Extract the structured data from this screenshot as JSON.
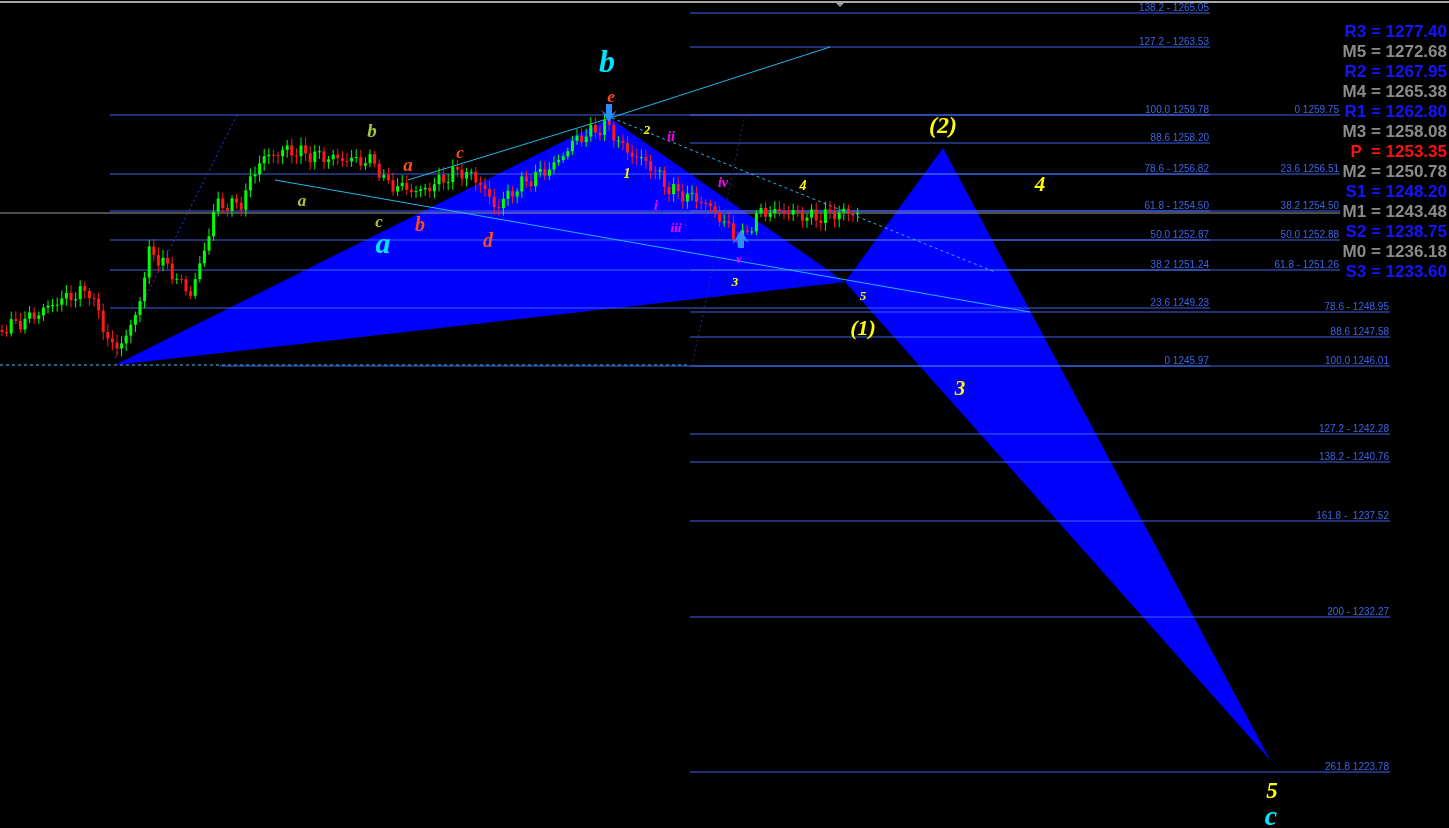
{
  "pivot_levels": [
    {
      "label": "R3 = 1277.40",
      "kind": "resistance"
    },
    {
      "label": "M5 = 1272.68",
      "kind": "mid"
    },
    {
      "label": "R2 = 1267.95",
      "kind": "resistance"
    },
    {
      "label": "M4 = 1265.38",
      "kind": "mid"
    },
    {
      "label": "R1 = 1262.80",
      "kind": "resistance"
    },
    {
      "label": "M3 = 1258.08",
      "kind": "mid"
    },
    {
      "label": "P  = 1253.35",
      "kind": "pivot"
    },
    {
      "label": "M2 = 1250.78",
      "kind": "mid"
    },
    {
      "label": "S1 = 1248.20",
      "kind": "support"
    },
    {
      "label": "M1 = 1243.48",
      "kind": "mid"
    },
    {
      "label": "S2 = 1238.75",
      "kind": "support"
    },
    {
      "label": "M0 = 1236.18",
      "kind": "mid"
    },
    {
      "label": "S3 = 1233.60",
      "kind": "support"
    }
  ],
  "fibonacci_upper": [
    "138.2 - 1265.05",
    "127.2 - 1263.53",
    "100.0 1259.78",
    "88.6 1258.20",
    "78.6 - 1256.82",
    "61.8 - 1254.50",
    "50.0 1252.87",
    "38.2 1251.24",
    "23.6 1249.23",
    "0 1245.97"
  ],
  "fibonacci_lower": [
    "0 1259.75",
    "23.6 1256.51",
    "38.2 1254.50",
    "50.0 1252.88",
    "61.8 - 1251.26",
    "78.6 - 1248.95",
    "88.6 1247.58",
    "100.0 1246.01",
    "127.2 - 1242.28",
    "138.2 - 1240.76",
    "161.8 -  1237.52",
    "200 - 1232.27",
    "261.8 1223.78"
  ],
  "wave_labels": [
    {
      "text": "b",
      "color": "#00e5ff"
    },
    {
      "text": "e",
      "color": "#ff4a1a"
    },
    {
      "text": "b",
      "color": "#a8c83c"
    },
    {
      "text": "a",
      "color": "#a8c83c"
    },
    {
      "text": "c",
      "color": "#a8c83c"
    },
    {
      "text": "a",
      "color": "#ff4a1a"
    },
    {
      "text": "c",
      "color": "#ff4a1a"
    },
    {
      "text": "b",
      "color": "#ff4a1a"
    },
    {
      "text": "d",
      "color": "#ff4a1a"
    },
    {
      "text": "a",
      "color": "#00e5ff"
    },
    {
      "text": "2",
      "color": "#ffff00"
    },
    {
      "text": "ii",
      "color": "#ff00ff"
    },
    {
      "text": "1",
      "color": "#ffff00"
    },
    {
      "text": "i",
      "color": "#ff00ff"
    },
    {
      "text": "iii",
      "color": "#ff00ff"
    },
    {
      "text": "iv",
      "color": "#ff00ff"
    },
    {
      "text": "v",
      "color": "#ff00ff"
    },
    {
      "text": "3",
      "color": "#ffff00"
    },
    {
      "text": "4",
      "color": "#ffff00"
    },
    {
      "text": "5",
      "color": "#ffff00"
    },
    {
      "text": "(2)",
      "color": "#ffff00"
    },
    {
      "text": "4",
      "color": "#ffff00"
    },
    {
      "text": "(1)",
      "color": "#ffff00"
    },
    {
      "text": "3",
      "color": "#ffff00"
    },
    {
      "text": "5",
      "color": "#ffff00"
    },
    {
      "text": "c",
      "color": "#00e5ff"
    }
  ]
}
